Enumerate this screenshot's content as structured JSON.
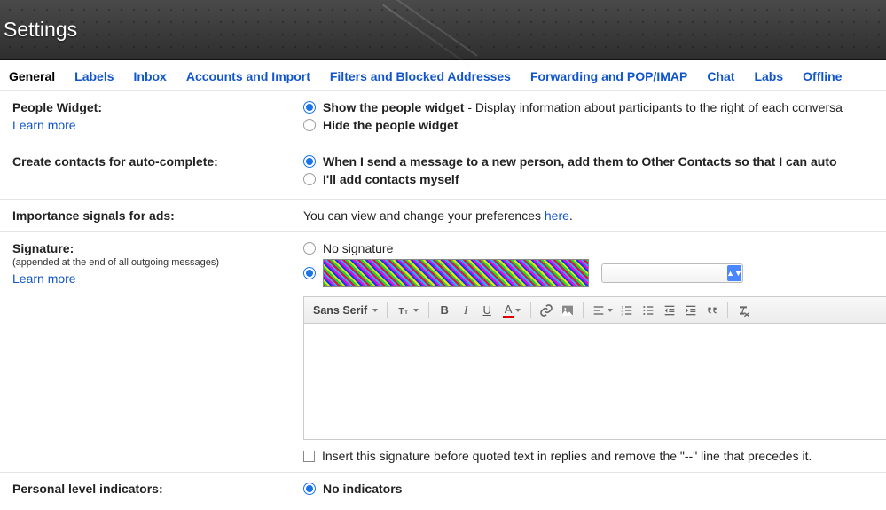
{
  "header": {
    "title": "Settings"
  },
  "tabs": [
    {
      "label": "General",
      "active": true
    },
    {
      "label": "Labels"
    },
    {
      "label": "Inbox"
    },
    {
      "label": "Accounts and Import"
    },
    {
      "label": "Filters and Blocked Addresses"
    },
    {
      "label": "Forwarding and POP/IMAP"
    },
    {
      "label": "Chat"
    },
    {
      "label": "Labs"
    },
    {
      "label": "Offline"
    }
  ],
  "people_widget": {
    "title": "People Widget:",
    "learn_more": "Learn more",
    "show_label": "Show the people widget",
    "show_desc": " - Display information about participants to the right of each conversa",
    "hide_label": "Hide the people widget",
    "selected": "show"
  },
  "auto_complete": {
    "title": "Create contacts for auto-complete:",
    "opt1": "When I send a message to a new person, add them to Other Contacts so that I can auto",
    "opt2": "I'll add contacts myself",
    "selected": "opt1"
  },
  "importance": {
    "title": "Importance signals for ads:",
    "text_before": "You can view and change your preferences ",
    "link": "here",
    "text_after": "."
  },
  "signature": {
    "title": "Signature:",
    "sub": "(appended at the end of all outgoing messages)",
    "learn_more": "Learn more",
    "no_sig": "No signature",
    "selected": "custom",
    "font_label": "Sans Serif",
    "insert_before": "Insert this signature before quoted text in replies and remove the \"--\" line that precedes it.",
    "insert_checked": false
  },
  "personal_level": {
    "title": "Personal level indicators:",
    "no_ind": "No indicators",
    "selected": "no_ind"
  }
}
